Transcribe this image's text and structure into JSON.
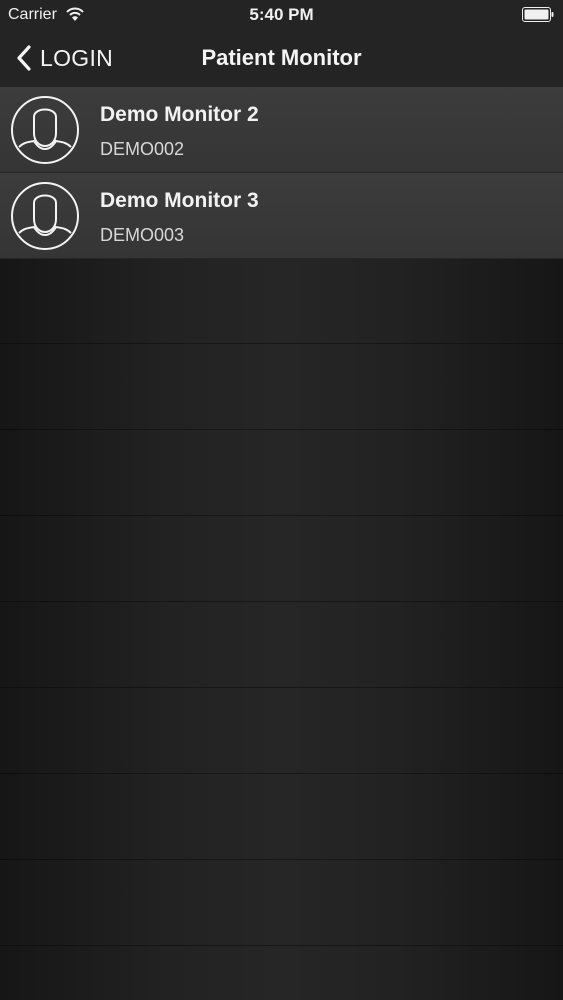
{
  "status_bar": {
    "carrier": "Carrier",
    "time": "5:40 PM"
  },
  "nav": {
    "back_label": "LOGIN",
    "title": "Patient Monitor"
  },
  "monitors": [
    {
      "name": "Demo Monitor 2",
      "id": "DEMO002",
      "icon": "person-avatar-icon"
    },
    {
      "name": "Demo Monitor 3",
      "id": "DEMO003",
      "icon": "person-avatar-icon"
    }
  ],
  "colors": {
    "background": "#222222",
    "row": "#3a3a3a",
    "text": "#f2f2f2"
  }
}
